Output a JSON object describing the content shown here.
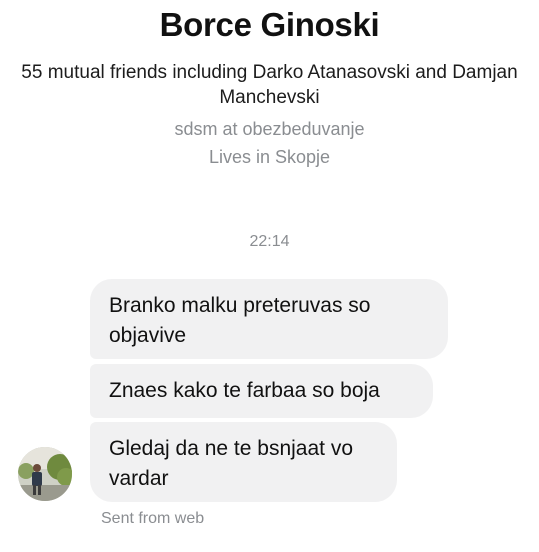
{
  "profile": {
    "name": "Borce Ginoski",
    "mutual_friends": "55 mutual friends including Darko Atanasovski and Damjan Manchevski",
    "work": "sdsm at obezbeduvanje",
    "lives": "Lives in Skopje"
  },
  "conversation": {
    "timestamp": "22:14",
    "messages": [
      "Branko malku preteruvas so objavive",
      "Znaes kako te farbaa so boja",
      "Gledaj da ne te bsnjaat vo vardar"
    ],
    "sent_from": "Sent from web"
  },
  "colors": {
    "bubble_background": "#f1f1f2",
    "secondary_text": "#8a8d91",
    "primary_text": "#111111"
  }
}
